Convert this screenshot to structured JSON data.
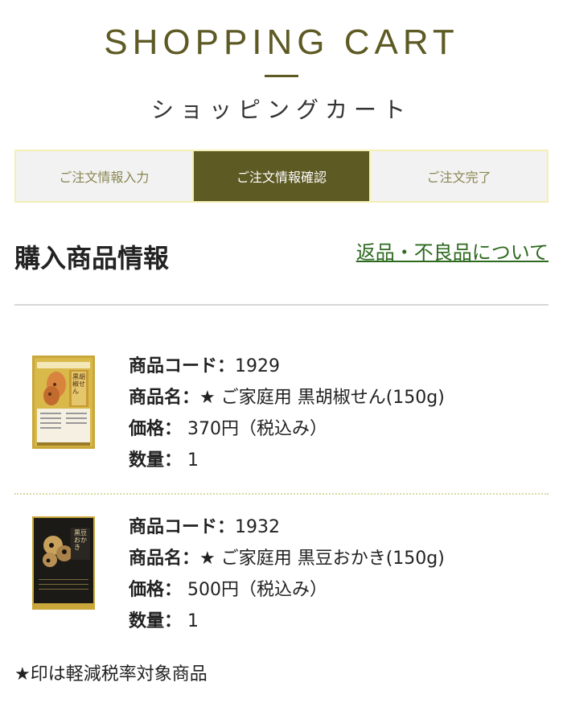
{
  "header": {
    "title_en": "SHOPPING CART",
    "title_ja": "ショッピングカート"
  },
  "steps": [
    {
      "label": "ご注文情報入力",
      "active": false
    },
    {
      "label": "ご注文情報確認",
      "active": true
    },
    {
      "label": "ご注文完了",
      "active": false
    }
  ],
  "section": {
    "title": "購入商品情報",
    "return_link": "返品・不良品について"
  },
  "labels": {
    "code": "商品コード：",
    "name": "商品名：",
    "price": "価格：",
    "qty": "数量："
  },
  "items": [
    {
      "code": "1929",
      "name": "★ ご家庭用 黒胡椒せん(150g)",
      "price": "370円（税込み）",
      "qty": "1",
      "package_text": "黒胡椒せん"
    },
    {
      "code": "1932",
      "name": "★ ご家庭用 黒豆おかき(150g)",
      "price": "500円（税込み）",
      "qty": "1",
      "package_text": "黒豆おかき"
    }
  ],
  "footnote": "★印は軽減税率対象商品",
  "colors": {
    "accent": "#5e5a24",
    "link": "#2d6a1f",
    "step_border": "#f2f0b2"
  }
}
